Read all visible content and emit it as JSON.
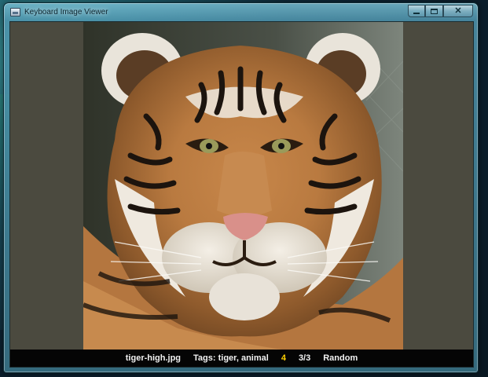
{
  "window": {
    "title": "Keyboard Image Viewer",
    "controls": {
      "minimize_icon": "minimize-icon",
      "maximize_icon": "maximize-icon",
      "close_icon": "close-icon"
    }
  },
  "viewer": {
    "image_subject": "tiger portrait",
    "background_color": "#4b4a3f"
  },
  "statusbar": {
    "filename": "tiger-high.jpg",
    "tags": "Tags: tiger, animal",
    "rating": "4",
    "position": "3/3",
    "mode": "Random",
    "rating_color": "#ffd100"
  }
}
